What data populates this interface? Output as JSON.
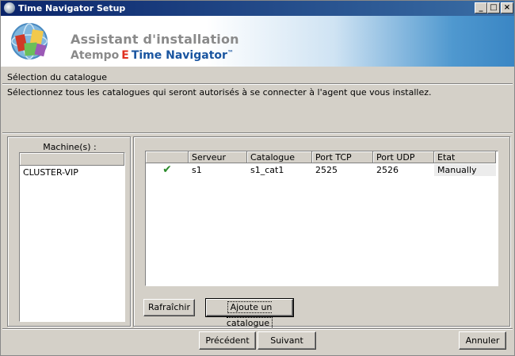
{
  "window": {
    "title": "Time Navigator Setup",
    "controls": {
      "minimize": "_",
      "maximize": "□",
      "close": "×"
    }
  },
  "banner": {
    "title": "Assistant d'installation",
    "brand_prefix": "Atempo",
    "brand_mark": "E",
    "brand_product": "Time Navigator",
    "brand_tm": "™"
  },
  "section": {
    "title": "Sélection du catalogue",
    "instructions": "Sélectionnez tous les catalogues qui seront autorisés à se connecter à l'agent que vous installez."
  },
  "machines": {
    "label": "Machine(s) :",
    "items": [
      "CLUSTER-VIP"
    ]
  },
  "catalog_table": {
    "columns": [
      "",
      "Serveur",
      "Catalogue",
      "Port TCP",
      "Port UDP",
      "Etat"
    ],
    "rows": [
      {
        "checked_icon": "check-icon",
        "check_glyph": "✔",
        "serveur": "s1",
        "catalogue": "s1_cat1",
        "port_tcp": "2525",
        "port_udp": "2526",
        "etat": "Manually"
      }
    ]
  },
  "buttons": {
    "refresh": "Rafraîchir",
    "add_catalog": "Ajoute un catalogue",
    "previous": "Précédent",
    "next": "Suivant",
    "cancel": "Annuler"
  },
  "colors": {
    "titlebar_start": "#0a246a",
    "titlebar_end": "#3a6ea5",
    "window_bg": "#d4d0c8",
    "brand_blue": "#1a55a0",
    "brand_red": "#e03020",
    "check_green": "#2a8a2a"
  }
}
